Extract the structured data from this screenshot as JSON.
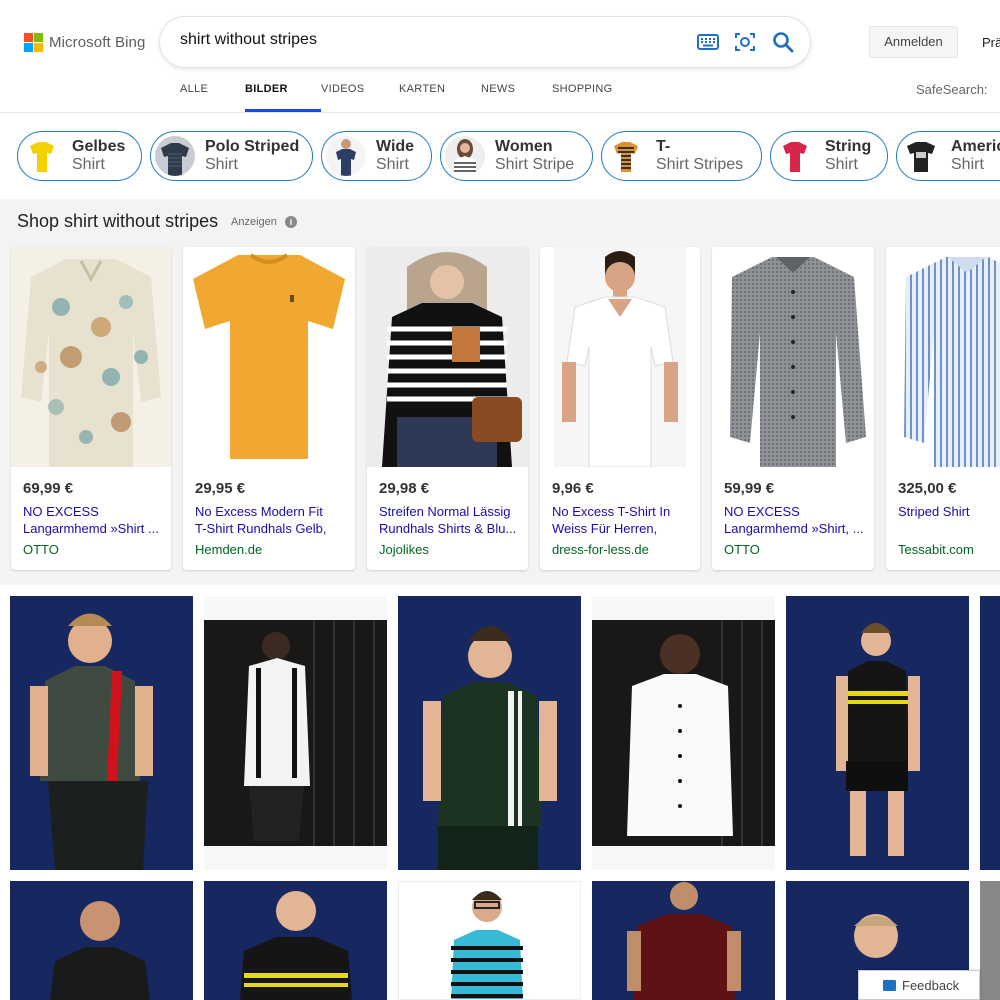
{
  "brand": {
    "name": "Microsoft Bing",
    "colors": [
      "#f25022",
      "#7fba00",
      "#00a4ef",
      "#ffb900"
    ]
  },
  "search": {
    "query": "shirt without stripes"
  },
  "header": {
    "signin_label": "Anmelden",
    "cut_label": "Prä"
  },
  "nav": {
    "items": [
      "ALLE",
      "BILDER",
      "VIDEOS",
      "KARTEN",
      "NEWS",
      "SHOPPING"
    ],
    "active": "BILDER"
  },
  "safesearch_label": "SafeSearch:",
  "related": [
    {
      "line1": "Gelbes",
      "line2": "Shirt"
    },
    {
      "line1": "Polo Striped",
      "line2": "Shirt"
    },
    {
      "line1": "Wide",
      "line2": "Shirt"
    },
    {
      "line1": "Women",
      "line2": "Shirt Stripe"
    },
    {
      "line1": "T-",
      "line2": "Shirt Stripes"
    },
    {
      "line1": "String",
      "line2": "Shirt"
    },
    {
      "line1": "Americ",
      "line2": "Shirt"
    }
  ],
  "shopping": {
    "title": "Shop shirt without stripes",
    "ads_label": "Anzeigen",
    "info_icon": "i",
    "products": [
      {
        "price": "69,99 €",
        "title": "NO EXCESS Langarmhemd »Shirt ...",
        "seller": "OTTO"
      },
      {
        "price": "29,95 €",
        "title": "No Excess Modern Fit T-Shirt Rundhals Gelb, Ein...",
        "seller": "Hemden.de"
      },
      {
        "price": "29,98 €",
        "title": "Streifen Normal Lässig Rundhals Shirts & Blu...",
        "seller": "Jojolikes"
      },
      {
        "price": "9,96 €",
        "title": "No Excess T-Shirt In Weiss Für Herren, Grö...",
        "seller": "dress-for-less.de"
      },
      {
        "price": "59,99 €",
        "title": "NO EXCESS Langarmhemd »Shirt, ...",
        "seller": "OTTO"
      },
      {
        "price": "325,00 €",
        "title": "Striped Shirt",
        "seller": "Tessabit.com"
      }
    ]
  },
  "feedback_label": "Feedback"
}
